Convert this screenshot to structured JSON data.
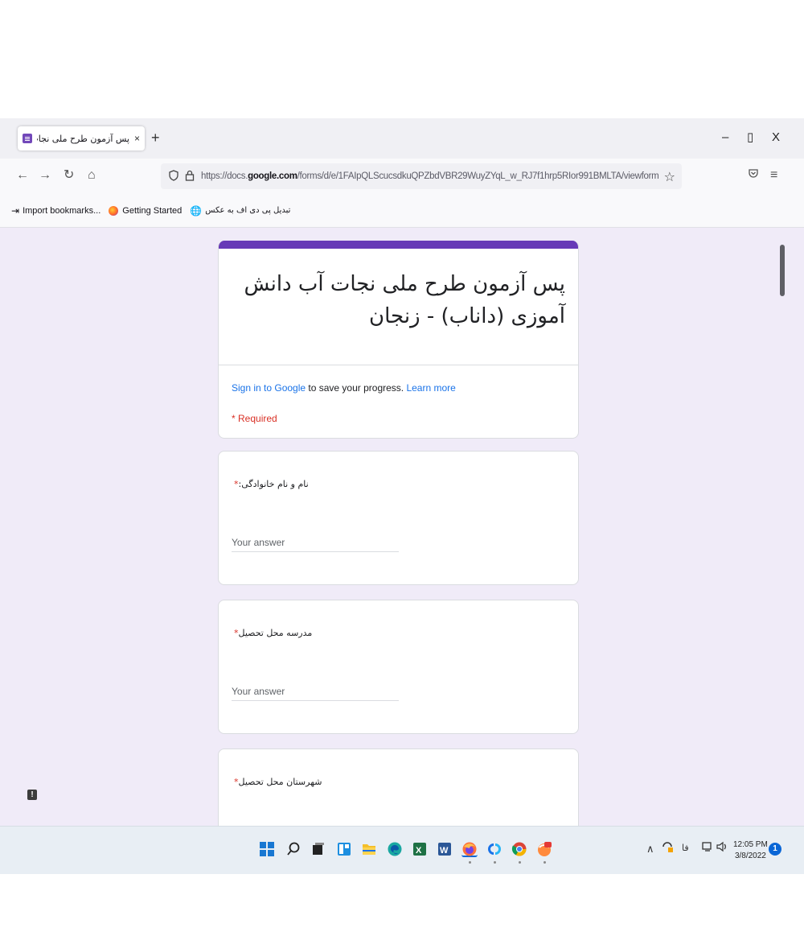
{
  "browser": {
    "tab": {
      "title": "پس آزمون طرح ملی نجات آب دان",
      "close": "×"
    },
    "new_tab": "+",
    "window_controls": {
      "minimize": "–",
      "maximize": "▯",
      "close": "X"
    },
    "nav": {
      "back": "←",
      "forward": "→",
      "reload": "↻",
      "home": "⌂"
    },
    "url": {
      "prefix": "https://docs.",
      "domain": "google.com",
      "path": "/forms/d/e/1FAIpQLScucsdkuQPZbdVBR29WuyZYqL_w_RJ7f1hrp5RIor991BMLTA/viewform"
    },
    "bookmarks": [
      {
        "label": "Import bookmarks...",
        "icon": "import-icon"
      },
      {
        "label": "Getting Started",
        "icon": "firefox-icon"
      },
      {
        "label": "تبدیل پی دی اف به عکس",
        "icon": "globe-icon"
      }
    ]
  },
  "form": {
    "title": "پس آزمون طرح ملی نجات آب دانش آموزی (داناب) - زنجان",
    "signin_link": "Sign in to Google",
    "signin_rest": " to save your progress. ",
    "learn_more": "Learn more",
    "required_note": "* Required",
    "questions": [
      {
        "label": "نام و نام خانوادگی:",
        "required_mark": "*",
        "placeholder": "Your answer"
      },
      {
        "label": "مدرسه محل تحصیل",
        "required_mark": "*",
        "placeholder": "Your answer"
      },
      {
        "label": "شهرستان محل تحصیل",
        "required_mark": "*"
      }
    ]
  },
  "feedback_icon": "!",
  "taskbar": {
    "lang": "فا",
    "time": "12:05 PM",
    "date": "3/8/2022",
    "notifications": "1"
  },
  "colors": {
    "accent": "#673ab7",
    "page_bg": "#f0ebf8",
    "required": "#d93025",
    "link": "#1a73e8"
  }
}
